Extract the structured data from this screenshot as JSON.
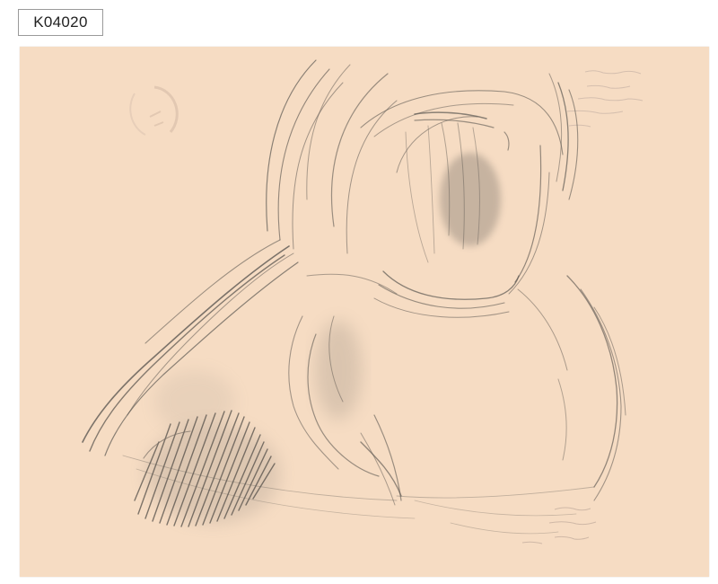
{
  "label": {
    "accession_number": "K04020"
  },
  "colors": {
    "page_background": "#ffffff",
    "paper": "#f6dcc3",
    "graphite": "#5d5852",
    "faint_notes": "#c8b4a6",
    "stamp": "#d8c0ad"
  },
  "artwork": {
    "medium": "graphite-on-paper",
    "subject_icon": "figure-sketch-icon",
    "stamp_icon": "collection-stamp-icon"
  }
}
